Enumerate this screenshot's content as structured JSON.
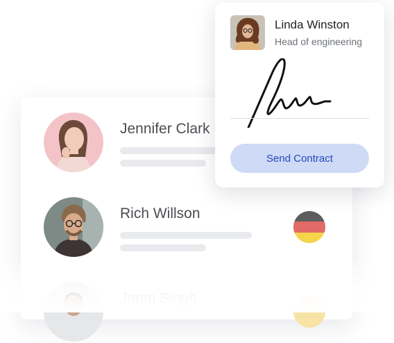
{
  "contacts": [
    {
      "name": "Jennifer Clark",
      "flag": null
    },
    {
      "name": "Rich Willson",
      "flag": "germany-flag"
    },
    {
      "name": "Janm Singh",
      "flag": "partial-flag"
    }
  ],
  "contract_card": {
    "name": "Linda Winston",
    "title": "Head of engineering",
    "button_label": "Send Contract"
  },
  "colors": {
    "button_bg": "#cfdaf6",
    "button_text": "#2547b8",
    "placeholder_bar": "#e9eaee",
    "flag_black": "#5d5d5d",
    "flag_red": "#e26a67",
    "flag_gold": "#f5d54a"
  }
}
